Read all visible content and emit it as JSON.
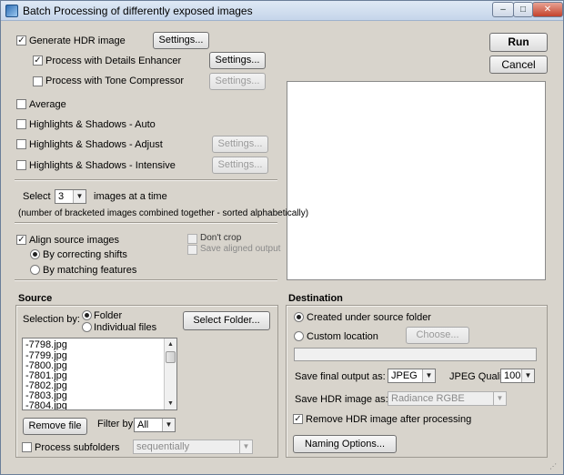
{
  "window": {
    "title": "Batch Processing of differently exposed images",
    "minimize": "–",
    "maximize": "□",
    "close": "✕"
  },
  "actions": {
    "run": "Run",
    "cancel": "Cancel"
  },
  "options": {
    "generate_hdr": {
      "label": "Generate HDR image",
      "checked": true,
      "settings": "Settings..."
    },
    "details_enhancer": {
      "label": "Process with Details Enhancer",
      "checked": true,
      "settings": "Settings..."
    },
    "tone_compressor": {
      "label": "Process with Tone Compressor",
      "checked": false,
      "settings": "Settings..."
    },
    "average": {
      "label": "Average",
      "checked": false
    },
    "hs_auto": {
      "label": "Highlights & Shadows - Auto",
      "checked": false
    },
    "hs_adjust": {
      "label": "Highlights & Shadows - Adjust",
      "checked": false,
      "settings": "Settings..."
    },
    "hs_intensive": {
      "label": "Highlights & Shadows - Intensive",
      "checked": false,
      "settings": "Settings..."
    }
  },
  "bracket": {
    "select_label": "Select",
    "count": "3",
    "suffix": "images at a time",
    "note": "(number of bracketed images combined together - sorted alphabetically)"
  },
  "align": {
    "label": "Align source images",
    "checked": true,
    "by_shifts": "By correcting shifts",
    "by_features": "By matching features",
    "dont_crop": "Don't crop",
    "save_aligned": "Save aligned output"
  },
  "source": {
    "heading": "Source",
    "selection_by": "Selection by:",
    "folder": "Folder",
    "individual_files": "Individual files",
    "select_folder": "Select Folder...",
    "files": [
      "-7798.jpg",
      "-7799.jpg",
      "-7800.jpg",
      "-7801.jpg",
      "-7802.jpg",
      "-7803.jpg",
      "-7804.jpg"
    ],
    "remove_file": "Remove file",
    "filter_by": "Filter by:",
    "filter_value": "All",
    "process_subfolders": "Process subfolders",
    "subfolder_mode": "sequentially",
    "arrow": "▼",
    "scroll_up": "▲"
  },
  "destination": {
    "heading": "Destination",
    "created_under": "Created under source folder",
    "custom_location": "Custom location",
    "choose": "Choose...",
    "save_final": "Save final output as:",
    "final_format": "JPEG",
    "jpeg_quality_label": "JPEG Quality:",
    "jpeg_quality": "100",
    "save_hdr": "Save HDR image as:",
    "hdr_format": "Radiance RGBE",
    "remove_hdr": "Remove HDR image after processing",
    "naming_options": "Naming Options..."
  },
  "glyphs": {
    "check": "✓"
  }
}
